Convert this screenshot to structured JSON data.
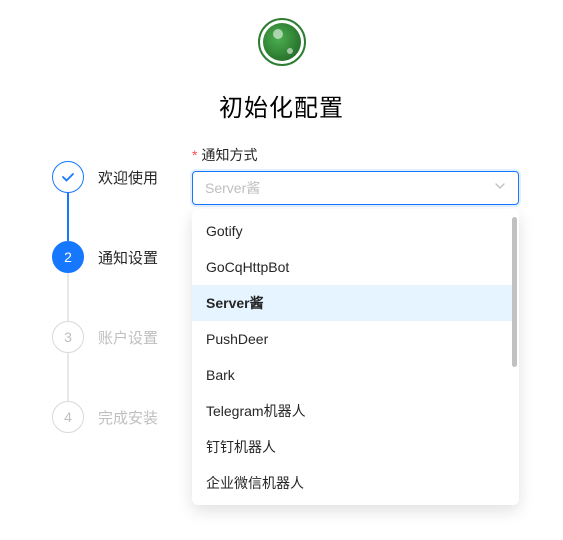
{
  "page": {
    "title": "初始化配置"
  },
  "steps": [
    {
      "label": "欢迎使用",
      "state": "done"
    },
    {
      "label": "通知设置",
      "state": "current"
    },
    {
      "label": "账户设置",
      "state": "pending",
      "num": "3"
    },
    {
      "label": "完成安装",
      "state": "pending",
      "num": "4"
    }
  ],
  "form": {
    "notify_label": "通知方式",
    "select_placeholder": "Server酱",
    "selected_value": "Server酱",
    "options": [
      "Gotify",
      "GoCqHttpBot",
      "Server酱",
      "PushDeer",
      "Bark",
      "Telegram机器人",
      "钉钉机器人",
      "企业微信机器人"
    ]
  },
  "icons": {
    "check": "✓",
    "step2": "2"
  }
}
